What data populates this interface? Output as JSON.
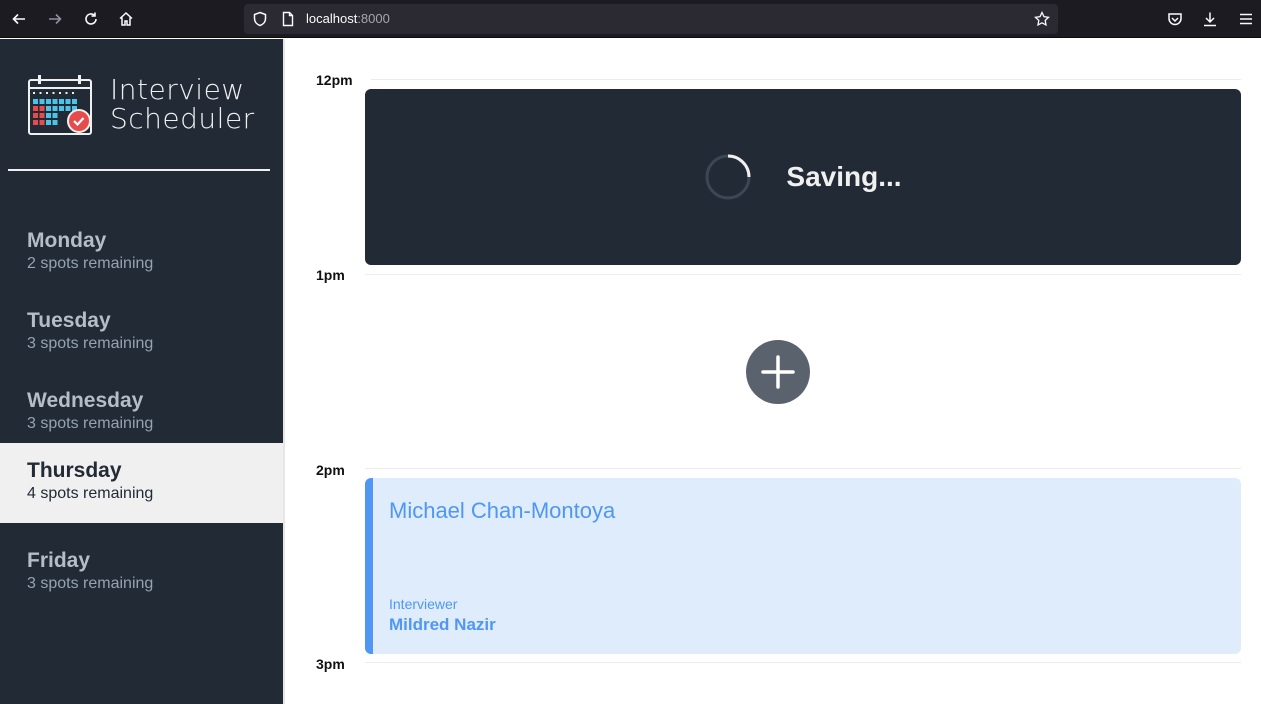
{
  "browser": {
    "url_host": "localhost",
    "url_port": ":8000"
  },
  "sidebar": {
    "brand_line1": "Interview",
    "brand_line2": "Scheduler",
    "days": [
      {
        "name": "Monday",
        "spots": "2 spots remaining",
        "selected": false
      },
      {
        "name": "Tuesday",
        "spots": "3 spots remaining",
        "selected": false
      },
      {
        "name": "Wednesday",
        "spots": "3 spots remaining",
        "selected": false
      },
      {
        "name": "Thursday",
        "spots": "4 spots remaining",
        "selected": true
      },
      {
        "name": "Friday",
        "spots": "3 spots remaining",
        "selected": false
      }
    ]
  },
  "schedule": {
    "times": [
      "12pm",
      "1pm",
      "2pm",
      "3pm"
    ],
    "status": {
      "text": "Saving..."
    },
    "appointment": {
      "student": "Michael Chan-Montoya",
      "interviewer_label": "Interviewer",
      "interviewer_name": "Mildred Nazir"
    }
  },
  "colors": {
    "sidebar_bg": "#222a36",
    "accent": "#4f97f3",
    "appointment_bg": "#dfecfc",
    "add_button": "#5a626d"
  }
}
